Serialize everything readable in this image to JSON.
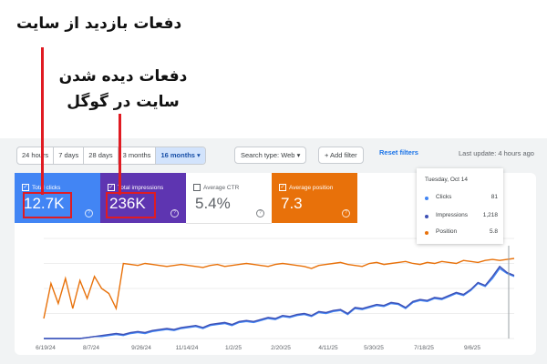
{
  "annotations": {
    "top_label": "دفعات بازدید از سایت",
    "mid_label_line1": "دفعات دیده شدن",
    "mid_label_line2": "سایت در گوگل"
  },
  "toolbar": {
    "date_chips": [
      "24 hours",
      "7 days",
      "28 days",
      "3 months",
      "16 months"
    ],
    "active_chip": "16 months",
    "search_type": "Search type: Web",
    "add_filter": "+ Add filter",
    "reset_filters": "Reset filters",
    "last_update": "Last update: 4 hours ago"
  },
  "metrics": [
    {
      "label": "Total clicks",
      "value": "12.7K",
      "checked": true,
      "color": "#4285f4"
    },
    {
      "label": "Total impressions",
      "value": "236K",
      "checked": true,
      "color": "#5e35b1"
    },
    {
      "label": "Average CTR",
      "value": "5.4%",
      "checked": false,
      "color": "#ffffff"
    },
    {
      "label": "Average position",
      "value": "7.3",
      "checked": true,
      "color": "#e8710a"
    }
  ],
  "tooltip": {
    "date": "Tuesday, Oct 14",
    "rows": [
      {
        "name": "Clicks",
        "value": "81",
        "color": "#4285f4"
      },
      {
        "name": "Impressions",
        "value": "1,218",
        "color": "#5e35b1"
      },
      {
        "name": "Position",
        "value": "5.8",
        "color": "#e8710a"
      }
    ]
  },
  "chart_data": {
    "type": "line",
    "x_ticks": [
      "6/19/24",
      "8/7/24",
      "9/26/24",
      "11/14/24",
      "1/2/25",
      "2/20/25",
      "4/11/25",
      "5/30/25",
      "7/18/25",
      "9/6/25"
    ],
    "series": [
      {
        "name": "Clicks",
        "color": "#4285f4",
        "values": [
          0,
          0,
          0,
          0,
          0,
          0,
          1,
          2,
          2,
          3,
          4,
          3,
          5,
          6,
          5,
          7,
          8,
          9,
          8,
          10,
          11,
          12,
          10,
          13,
          14,
          15,
          13,
          16,
          17,
          16,
          18,
          20,
          19,
          22,
          21,
          23,
          24,
          22,
          26,
          25,
          27,
          28,
          24,
          30,
          29,
          31,
          33,
          32,
          35,
          34,
          30,
          36,
          38,
          37,
          40,
          39,
          42,
          45,
          43,
          48,
          55,
          52,
          60,
          70,
          65,
          62
        ]
      },
      {
        "name": "Impressions",
        "color": "#3f51b5",
        "values": [
          0,
          0,
          0,
          0,
          0,
          0,
          1,
          2,
          3,
          4,
          5,
          4,
          6,
          7,
          6,
          8,
          9,
          10,
          9,
          11,
          12,
          13,
          11,
          14,
          15,
          16,
          14,
          17,
          18,
          17,
          19,
          21,
          20,
          23,
          22,
          24,
          25,
          23,
          27,
          26,
          28,
          29,
          25,
          31,
          30,
          32,
          34,
          33,
          36,
          35,
          31,
          37,
          39,
          38,
          41,
          40,
          43,
          46,
          44,
          49,
          56,
          53,
          62,
          72,
          66,
          63
        ]
      },
      {
        "name": "Position",
        "color": "#e8710a",
        "values": [
          20,
          55,
          35,
          60,
          30,
          58,
          40,
          62,
          50,
          45,
          30,
          75,
          74,
          73,
          75,
          74,
          73,
          72,
          73,
          74,
          73,
          72,
          71,
          73,
          74,
          72,
          73,
          74,
          75,
          74,
          73,
          72,
          74,
          75,
          74,
          73,
          72,
          70,
          73,
          74,
          75,
          76,
          74,
          73,
          72,
          75,
          76,
          74,
          75,
          76,
          77,
          75,
          74,
          76,
          75,
          77,
          76,
          75,
          78,
          77,
          76,
          78,
          79,
          78,
          79,
          80
        ]
      }
    ]
  }
}
